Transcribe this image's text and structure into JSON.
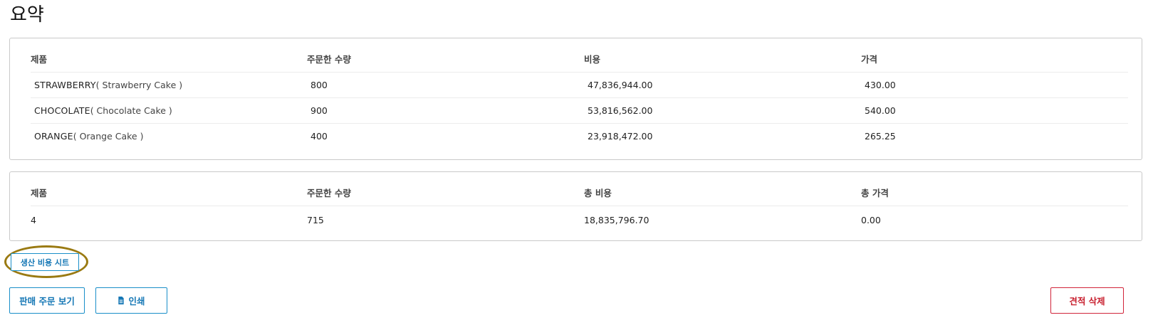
{
  "page": {
    "title": "요약"
  },
  "lines_table": {
    "headers": [
      "제품",
      "주문한 수량",
      "비용",
      "가격"
    ],
    "rows": [
      {
        "code": "STRAWBERRY",
        "desc": "( Strawberry Cake )",
        "qty": "800",
        "cost": "47,836,944.00",
        "price": "430.00"
      },
      {
        "code": "CHOCOLATE",
        "desc": "( Chocolate Cake )",
        "qty": "900",
        "cost": "53,816,562.00",
        "price": "540.00"
      },
      {
        "code": "ORANGE",
        "desc": "( Orange Cake )",
        "qty": "400",
        "cost": "23,918,472.00",
        "price": "265.25"
      }
    ]
  },
  "totals_table": {
    "headers": [
      "제품",
      "주문한 수량",
      "총 비용",
      "총 가격"
    ],
    "row": {
      "products": "4",
      "qty": "715",
      "total_cost": "18,835,796.70",
      "total_price": "0.00"
    }
  },
  "actions": {
    "cost_sheet_label": "생산 비용 시트",
    "view_order_label": "판매 주문 보기",
    "print_label": "인쇄",
    "delete_label": "견적 삭제",
    "print_icon": "document-icon"
  },
  "colors": {
    "primary": "#1a8fc9",
    "danger": "#d1243a",
    "highlight": "#9a7a12",
    "border": "#c9c9c9"
  }
}
